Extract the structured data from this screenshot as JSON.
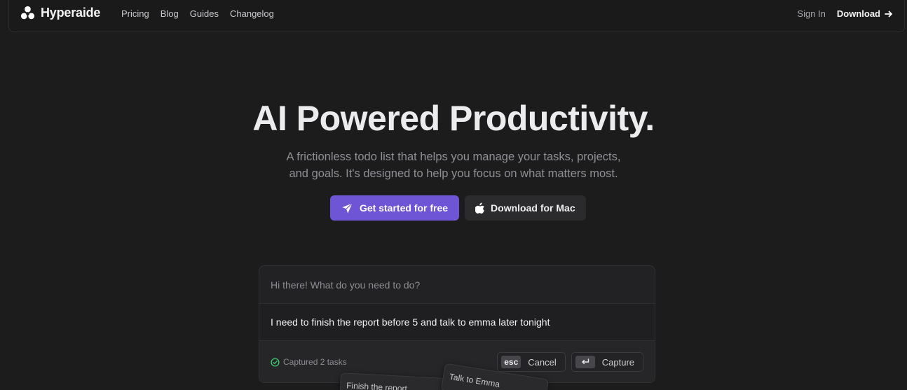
{
  "nav": {
    "brand": "Hyperaide",
    "links": [
      "Pricing",
      "Blog",
      "Guides",
      "Changelog"
    ],
    "sign_in": "Sign In",
    "download": "Download"
  },
  "hero": {
    "title": "AI Powered Productivity.",
    "subtitle_line1": "A frictionless todo list that helps you manage your tasks, projects,",
    "subtitle_line2": "and goals. It's designed to help you focus on what matters most.",
    "primary_cta": "Get started for free",
    "secondary_cta": "Download for Mac"
  },
  "demo": {
    "prompt": "Hi there! What do you need to do?",
    "input": "I need to finish the report before 5 and talk to emma later tonight",
    "status": "Captured 2 tasks",
    "cancel_key": "esc",
    "cancel_label": "Cancel",
    "capture_label": "Capture",
    "cards": [
      "Finish the report",
      "Talk to Emma"
    ]
  },
  "colors": {
    "background": "#1d1c1d",
    "accent": "#6d55d6",
    "success": "#3ccf6e"
  }
}
